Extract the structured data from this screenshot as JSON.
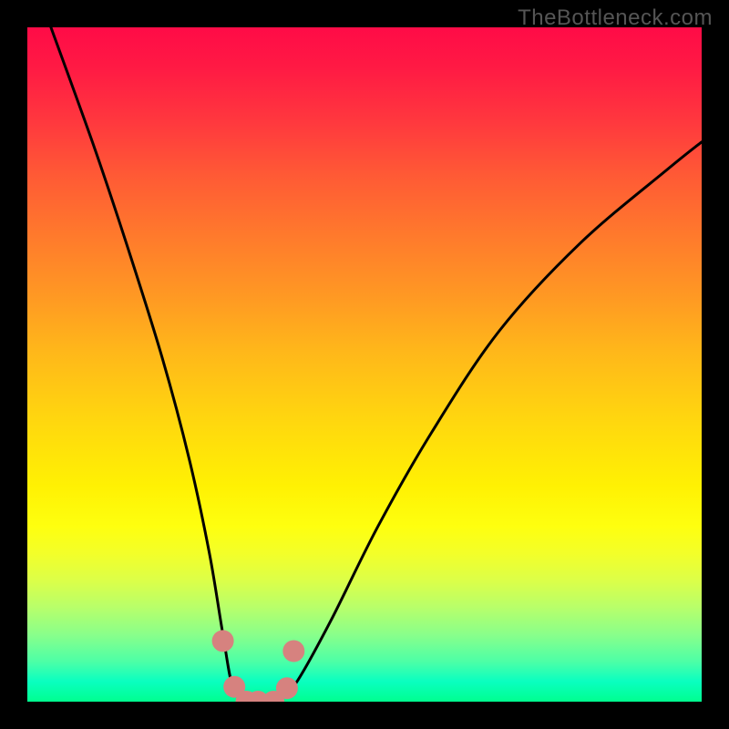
{
  "watermark": {
    "text": "TheBottleneck.com"
  },
  "colors": {
    "background": "#000000",
    "curve_stroke": "#000000",
    "marker_fill": "#d6827f",
    "gradient_top": "#ff0b47",
    "gradient_bottom": "#00ff8f"
  },
  "chart_data": {
    "type": "line",
    "title": "",
    "xlabel": "",
    "ylabel": "",
    "x_range": [
      0,
      100
    ],
    "y_range_percent": [
      0,
      100
    ],
    "series": [
      {
        "name": "bottleneck-curve",
        "x": [
          3.5,
          10,
          15,
          20,
          24,
          27,
          29,
          30.5,
          32.5,
          35,
          37.5,
          40,
          45,
          52,
          60,
          70,
          82,
          95,
          100
        ],
        "values": [
          100,
          82,
          67,
          51,
          36,
          22,
          10,
          2,
          0,
          0,
          0.5,
          3,
          12,
          26,
          40,
          55,
          68,
          79,
          83
        ]
      }
    ],
    "markers": [
      {
        "x": 29.0,
        "y": 9.0
      },
      {
        "x": 30.7,
        "y": 2.2
      },
      {
        "x": 32.5,
        "y": 0.0
      },
      {
        "x": 34.2,
        "y": 0.0
      },
      {
        "x": 36.5,
        "y": 0.0
      },
      {
        "x": 38.5,
        "y": 2.0
      },
      {
        "x": 39.5,
        "y": 7.5
      }
    ],
    "marker_radius_px": 12,
    "curve_stroke_px": 3
  }
}
